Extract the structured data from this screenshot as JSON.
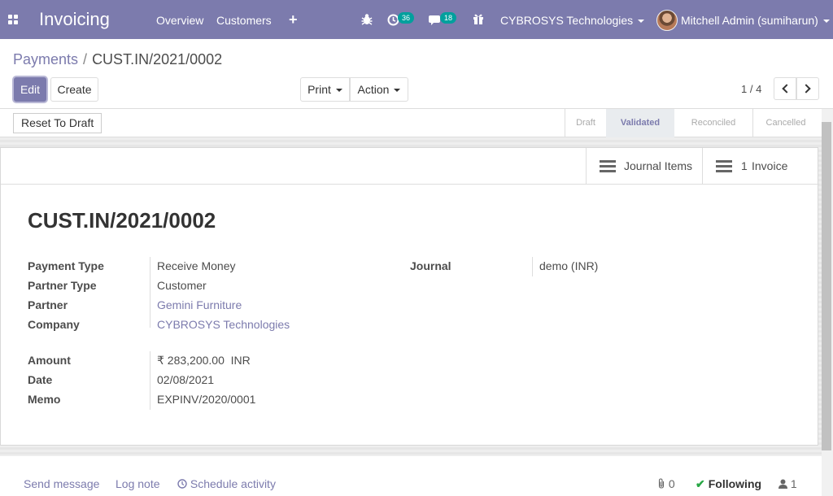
{
  "navbar": {
    "app_title": "Invoicing",
    "menu": [
      "Overview",
      "Customers"
    ],
    "activity_count": "36",
    "message_count": "18",
    "company": "CYBROSYS Technologies",
    "user": "Mitchell Admin (sumiharun)"
  },
  "breadcrumb": {
    "parent": "Payments",
    "separator": "/",
    "current": "CUST.IN/2021/0002"
  },
  "actions": {
    "edit": "Edit",
    "create": "Create",
    "print": "Print",
    "action": "Action",
    "pager": "1 / 4"
  },
  "status": {
    "reset_label": "Reset To Draft",
    "stages": [
      "Draft",
      "Validated",
      "Reconciled",
      "Cancelled"
    ],
    "active_stage": "Validated"
  },
  "smart_buttons": {
    "journal_items": "Journal Items",
    "invoice_count": "1",
    "invoice_label": "Invoice"
  },
  "record": {
    "title": "CUST.IN/2021/0002",
    "payment_type_label": "Payment Type",
    "payment_type": "Receive Money",
    "partner_type_label": "Partner Type",
    "partner_type": "Customer",
    "partner_label": "Partner",
    "partner": "Gemini Furniture",
    "company_label": "Company",
    "company": "CYBROSYS Technologies",
    "amount_label": "Amount",
    "amount": "₹ 283,200.00  INR",
    "date_label": "Date",
    "date": "02/08/2021",
    "memo_label": "Memo",
    "memo": "EXPINV/2020/0001",
    "journal_label": "Journal",
    "journal": "demo (INR)"
  },
  "chatter": {
    "send_message": "Send message",
    "log_note": "Log note",
    "schedule_activity": "Schedule activity",
    "attachments": "0",
    "following": "Following",
    "followers": "1"
  },
  "colors": {
    "brand": "#7c7bad",
    "badge": "#00a09d",
    "success": "#28a745"
  }
}
